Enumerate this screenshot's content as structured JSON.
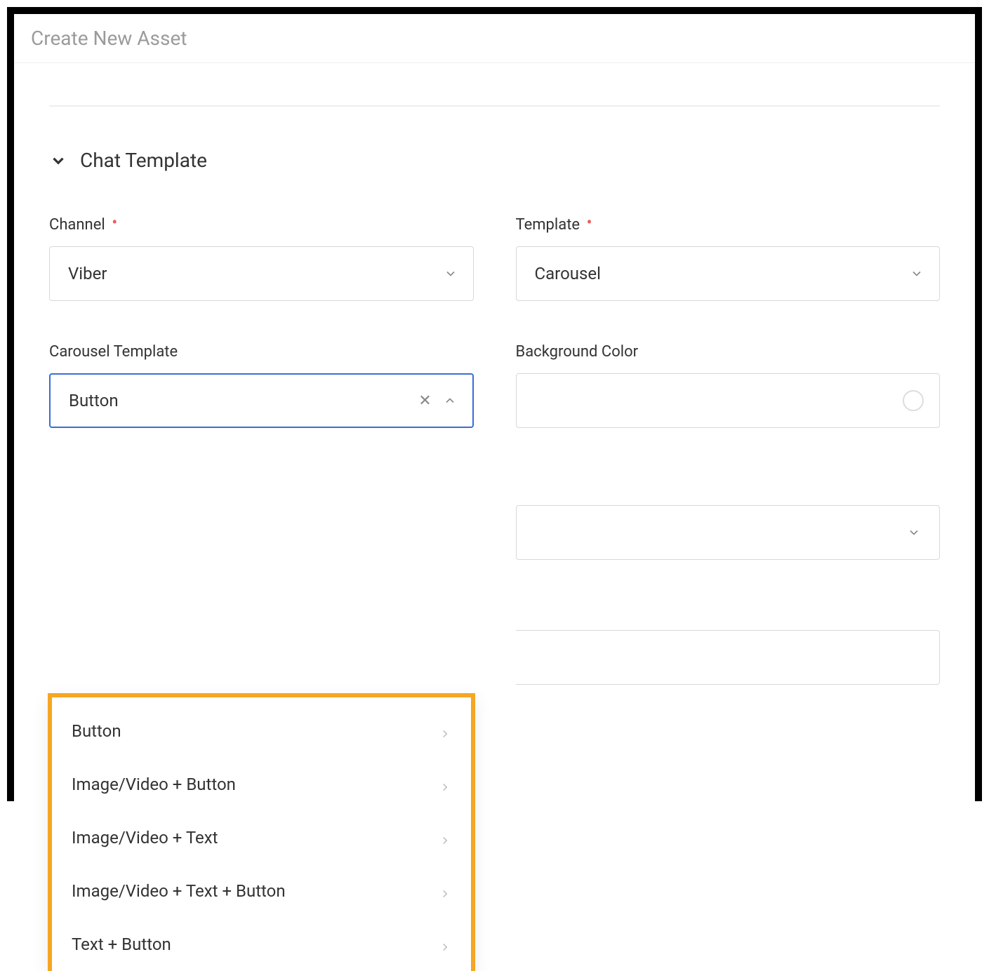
{
  "page_title": "Create New Asset",
  "section": {
    "title": "Chat Template"
  },
  "fields": {
    "channel": {
      "label": "Channel",
      "value": "Viber",
      "required": true
    },
    "template": {
      "label": "Template",
      "value": "Carousel",
      "required": true
    },
    "carousel_template": {
      "label": "Carousel Template",
      "value": "Button",
      "options": [
        "Button",
        "Image/Video + Button",
        "Image/Video + Text",
        "Image/Video + Text + Button",
        "Text + Button"
      ]
    },
    "background_color": {
      "label": "Background Color",
      "value": ""
    }
  },
  "colors": {
    "highlight": "#f5a623",
    "focus_border": "#3a6dd8",
    "required": "#f05a5a"
  }
}
